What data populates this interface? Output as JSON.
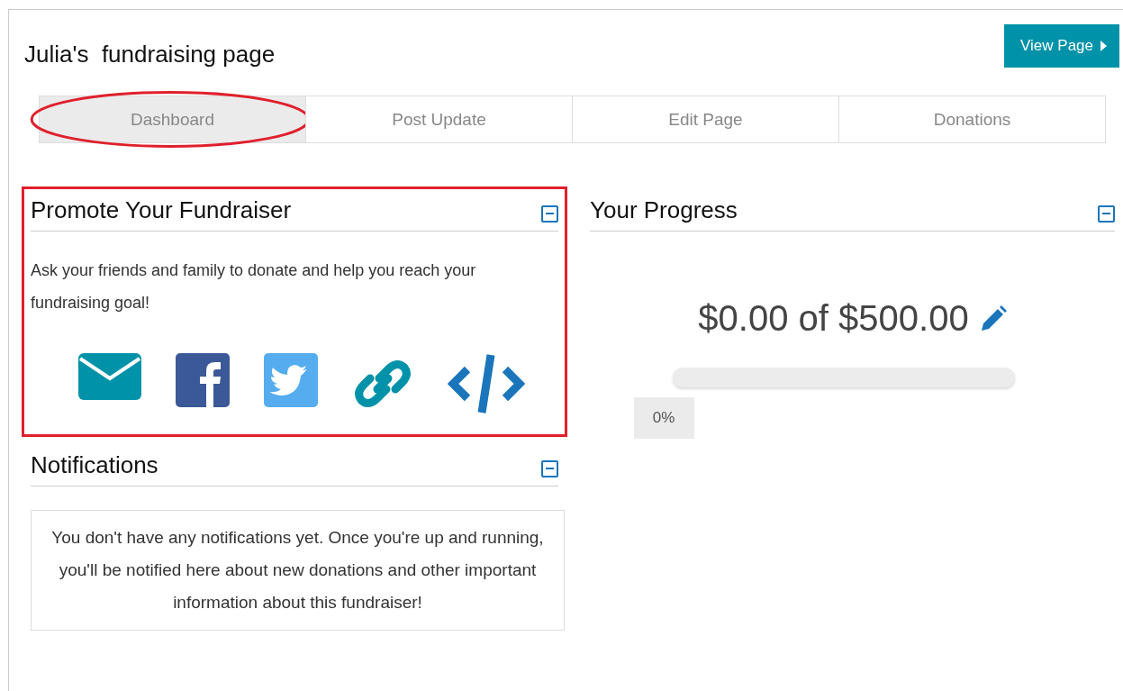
{
  "page": {
    "title": "Julia's  fundraising page",
    "view_button": "View Page"
  },
  "tabs": [
    {
      "label": "Dashboard",
      "selected": true,
      "annotated": true
    },
    {
      "label": "Post Update",
      "selected": false,
      "annotated": false
    },
    {
      "label": "Edit Page",
      "selected": false,
      "annotated": false
    },
    {
      "label": "Donations",
      "selected": false,
      "annotated": false
    }
  ],
  "promote": {
    "title": "Promote Your Fundraiser",
    "annotated": true,
    "text": "Ask your friends and family to donate and help you reach your fundraising goal!",
    "share_buttons": [
      {
        "kind": "email"
      },
      {
        "kind": "facebook"
      },
      {
        "kind": "twitter"
      },
      {
        "kind": "link"
      },
      {
        "kind": "embed"
      }
    ]
  },
  "notifications": {
    "title": "Notifications",
    "text": "You don't have any notifications yet. Once you're up and running, you'll be notified here about new donations and other important information about this fundraiser!"
  },
  "progress": {
    "title": "Your Progress",
    "amount": "$0.00 of $500.00",
    "level": 0,
    "percent": "0%"
  }
}
